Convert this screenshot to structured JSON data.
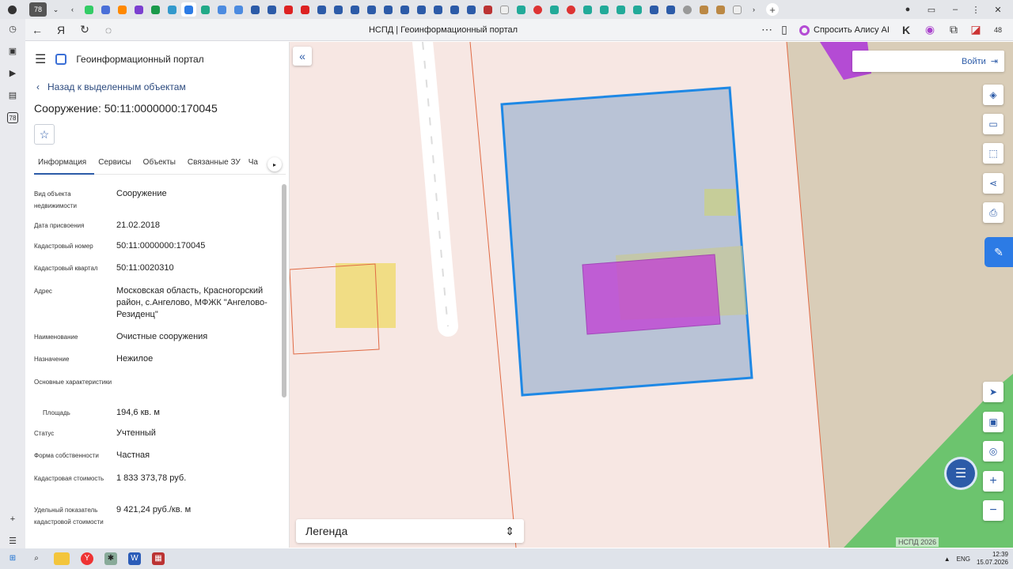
{
  "browser": {
    "tab_number_badge": "78",
    "page_title": "НСПД | Геоинформационный портал",
    "alice_button": "Спросить Алису AI",
    "notification_count": "48"
  },
  "rail": {
    "badge": "78"
  },
  "portal": {
    "title": "Геоинформационный портал",
    "back_link": "Назад к выделенным объектам",
    "object_title": "Сооружение: 50:11:0000000:170045",
    "tabs": [
      "Информация",
      "Сервисы",
      "Объекты",
      "Связанные ЗУ",
      "Ча"
    ],
    "info": [
      {
        "key": "Вид объекта недвижимости",
        "value": "Сооружение"
      },
      {
        "key": "Дата присвоения",
        "value": "21.02.2018"
      },
      {
        "key": "Кадастровый номер",
        "value": "50:11:0000000:170045"
      },
      {
        "key": "Кадастровый квартал",
        "value": "50:11:0020310"
      },
      {
        "key": "Адрес",
        "value": "Московская область, Красногорский район, с.Ангелово, МФЖК \"Ангелово-Резиденц\""
      },
      {
        "key": "Наименование",
        "value": "Очистные сооружения"
      },
      {
        "key": "Назначение",
        "value": "Нежилое"
      },
      {
        "key": "Основные характеристики",
        "value": ""
      },
      {
        "key": "Площадь",
        "value": "194,6 кв. м"
      },
      {
        "key": "Статус",
        "value": "Учтенный"
      },
      {
        "key": "Форма собственности",
        "value": "Частная"
      },
      {
        "key": "Кадастровая стоимость",
        "value": "1 833 373,78 руб."
      },
      {
        "key": "Удельный показатель кадастровой стоимости",
        "value": "9 421,24 руб./кв. м"
      }
    ]
  },
  "map": {
    "login": "Войти",
    "legend": "Легенда",
    "copyright": "НСПД 2026",
    "colors": {
      "background": "#f7e7e3",
      "selected_outline": "#1e88e5",
      "selected_fill": "#b9c3d6",
      "building_fill": "#c23bd4",
      "parcel_line": "#e06a44",
      "green_zone": "#6cc46e"
    }
  },
  "taskbar": {
    "lang": "ENG",
    "time": "12:39",
    "date": "15.07.2026"
  }
}
